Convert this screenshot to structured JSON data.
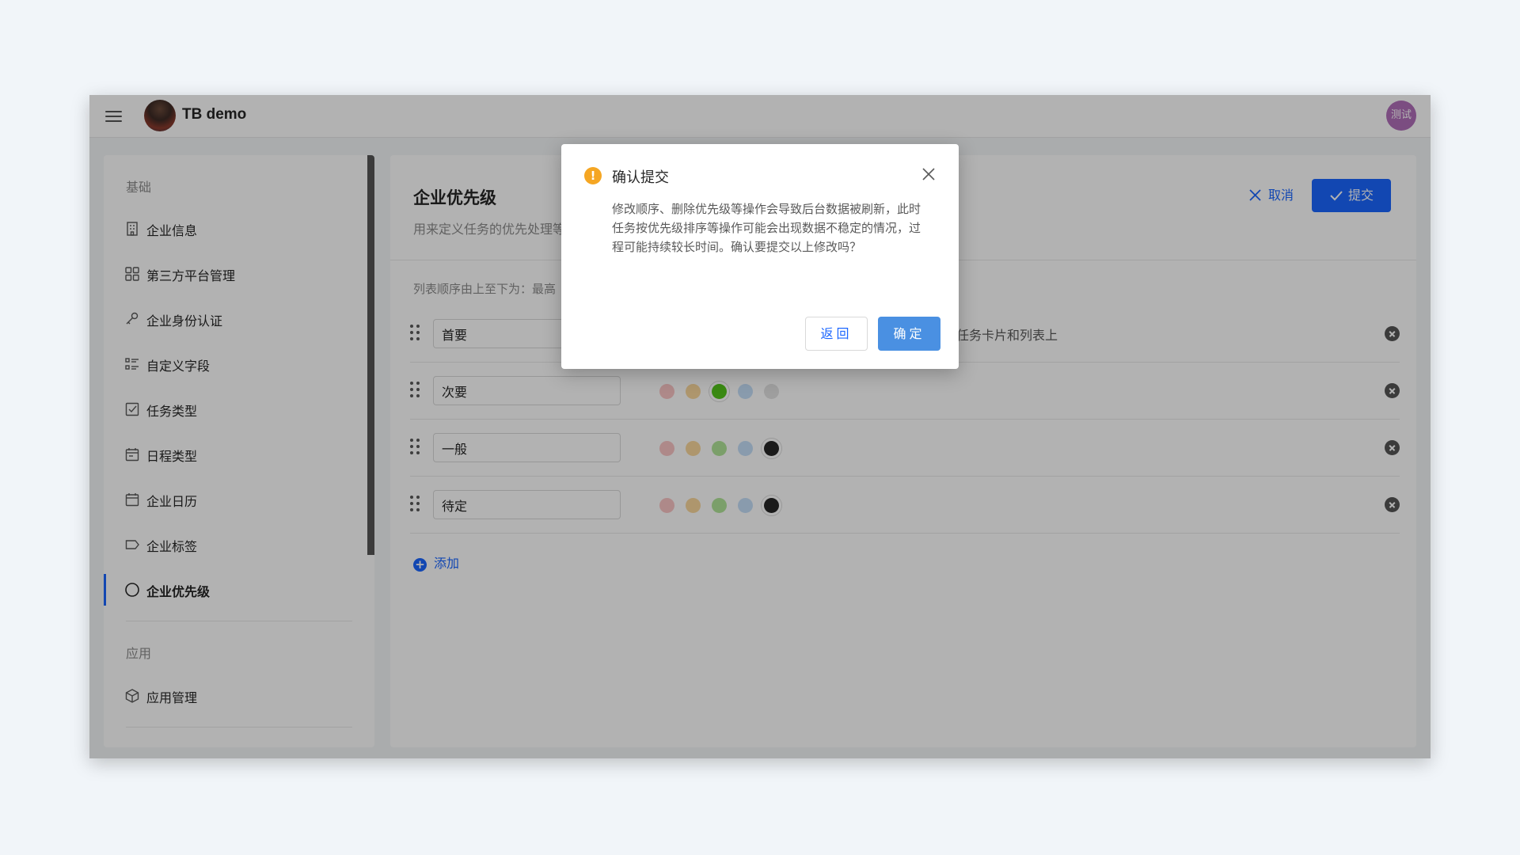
{
  "app": {
    "org_name": "TB demo",
    "user_avatar_text": "测试"
  },
  "sidebar": {
    "section_basic": "基础",
    "items": [
      {
        "label": "企业信息",
        "icon": "building-icon"
      },
      {
        "label": "第三方平台管理",
        "icon": "apps-grid-icon"
      },
      {
        "label": "企业身份认证",
        "icon": "key-icon"
      },
      {
        "label": "自定义字段",
        "icon": "custom-fields-icon"
      },
      {
        "label": "任务类型",
        "icon": "checkbox-icon"
      },
      {
        "label": "日程类型",
        "icon": "schedule-icon"
      },
      {
        "label": "企业日历",
        "icon": "calendar-icon"
      },
      {
        "label": "企业标签",
        "icon": "tag-icon"
      },
      {
        "label": "企业优先级",
        "icon": "circle-icon",
        "active": true
      }
    ],
    "section_apps": "应用",
    "app_items": [
      {
        "label": "应用管理",
        "icon": "package-icon"
      }
    ]
  },
  "main": {
    "title": "企业优先级",
    "subtitle": "用来定义任务的优先处理等",
    "cancel_label": "取消",
    "submit_label": "提交",
    "order_hint": "列表顺序由上至下为：最高",
    "first_row_desc": "任务卡片和列表上",
    "swatch_colors": [
      "#f47c7c",
      "#f5a623",
      "#52c41a",
      "#7cb8f0",
      "#bfbfbf",
      "#262626"
    ],
    "priorities": [
      {
        "name": "首要",
        "selected_color": 0
      },
      {
        "name": "次要",
        "selected_color": 2
      },
      {
        "name": "一般",
        "selected_color": 5
      },
      {
        "name": "待定",
        "selected_color": 5
      }
    ],
    "add_label": "添加"
  },
  "modal": {
    "title": "确认提交",
    "body": "修改顺序、删除优先级等操作会导致后台数据被刷新，此时任务按优先级排序等操作可能会出现数据不稳定的情况，过程可能持续较长时间。确认要提交以上修改吗？",
    "back_label": "返回",
    "confirm_label": "确定"
  },
  "colors": {
    "accent": "#1b66ff",
    "warning": "#f5a623"
  }
}
